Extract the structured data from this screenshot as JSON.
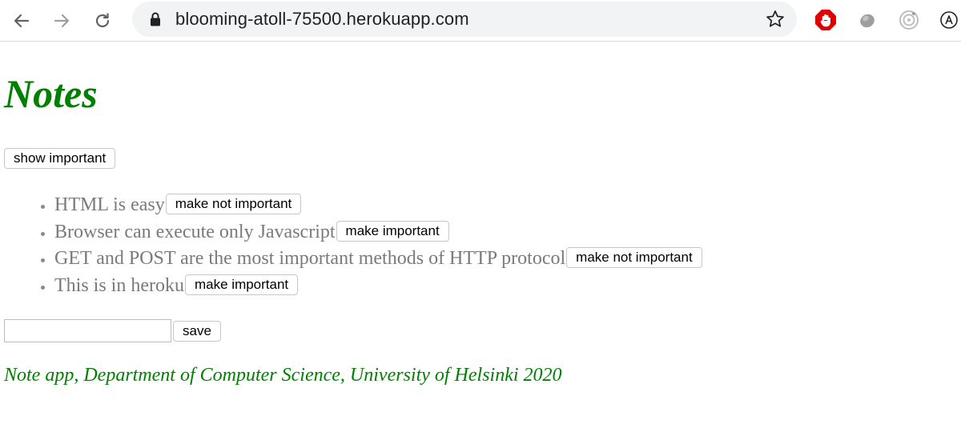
{
  "browser": {
    "url": "blooming-atoll-75500.herokuapp.com",
    "icons": {
      "back": "back-arrow-icon",
      "forward": "forward-arrow-icon",
      "reload": "reload-icon",
      "lock": "lock-icon",
      "bookmark": "star-icon",
      "ext1": "adblock-stop-icon",
      "ext2": "grey-blob-extension-icon",
      "ext3": "circle-target-extension-icon",
      "ext4": "circled-a-extension-icon"
    }
  },
  "page": {
    "title": "Notes",
    "show_button": "show important",
    "notes": [
      {
        "content": "HTML is easy",
        "button": "make not important"
      },
      {
        "content": "Browser can execute only Javascript",
        "button": "make important"
      },
      {
        "content": "GET and POST are the most important methods of HTTP protocol",
        "button": "make not important"
      },
      {
        "content": "This is in heroku",
        "button": "make important"
      }
    ],
    "input_value": "",
    "save_button": "save",
    "footer": "Note app, Department of Computer Science, University of Helsinki 2020"
  },
  "colors": {
    "title": "#008000",
    "note_text": "#7a7a7a",
    "adblock_red": "#e00000"
  }
}
